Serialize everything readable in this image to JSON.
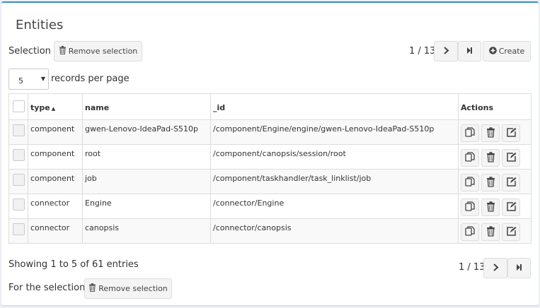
{
  "panel": {
    "title": "Entities"
  },
  "selection": {
    "label": "Selection :",
    "remove_label": "Remove selection"
  },
  "pager": {
    "text": "1 / 13"
  },
  "create_label": "Create",
  "per_page": {
    "value": "5",
    "label": "records per page"
  },
  "table": {
    "headers": [
      "type",
      "name",
      "_id",
      "Actions"
    ],
    "rows": [
      {
        "type": "component",
        "name": "gwen-Lenovo-IdeaPad-S510p",
        "id": "/component/Engine/engine/gwen-Lenovo-IdeaPad-S510p"
      },
      {
        "type": "component",
        "name": "root",
        "id": "/component/canopsis/session/root"
      },
      {
        "type": "component",
        "name": "job",
        "id": "/component/taskhandler/task_linklist/job"
      },
      {
        "type": "connector",
        "name": "Engine",
        "id": "/connector/Engine"
      },
      {
        "type": "connector",
        "name": "canopsis",
        "id": "/connector/canopsis"
      }
    ]
  },
  "footer": {
    "showing": "Showing 1 to 5 of 61 entries",
    "pager_text": "1 / 13",
    "selection_label": "For the selection :",
    "remove_label": "Remove selection"
  },
  "icons": {
    "next": "chevron-right-icon",
    "last": "step-forward-icon",
    "create": "plus-circle-icon",
    "trash": "trash-icon",
    "duplicate": "copy-icon",
    "edit": "edit-icon"
  }
}
